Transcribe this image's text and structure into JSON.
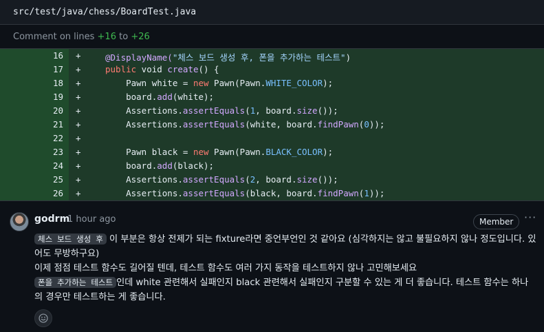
{
  "file": {
    "path": "src/test/java/chess/BoardTest.java"
  },
  "comment_range": {
    "prefix": "Comment on lines",
    "from": "+16",
    "joiner": "to",
    "to": "+26"
  },
  "code_lines": [
    {
      "num": "16",
      "sign": "+"
    },
    {
      "num": "17",
      "sign": "+"
    },
    {
      "num": "18",
      "sign": "+"
    },
    {
      "num": "19",
      "sign": "+"
    },
    {
      "num": "20",
      "sign": "+"
    },
    {
      "num": "21",
      "sign": "+"
    },
    {
      "num": "22",
      "sign": "+"
    },
    {
      "num": "23",
      "sign": "+"
    },
    {
      "num": "24",
      "sign": "+"
    },
    {
      "num": "25",
      "sign": "+"
    },
    {
      "num": "26",
      "sign": "+"
    }
  ],
  "code_text": {
    "l16_ann": "@DisplayName(",
    "l16_str": "\"체스 보드 생성 후, 폰을 추가하는 테스트\"",
    "l16_end": ")",
    "l17_kw": "public",
    "l17_rest": " void ",
    "l17_fn": "create",
    "l17_end": "() {",
    "l18_a": "    Pawn white = ",
    "l18_kw": "new",
    "l18_b": " Pawn(Pawn.",
    "l18_const": "WHITE_COLOR",
    "l18_c": ");",
    "l19_a": "    board.",
    "l19_fn": "add",
    "l19_b": "(white);",
    "l20_a": "    Assertions.",
    "l20_fn": "assertEquals",
    "l20_b": "(",
    "l20_num": "1",
    "l20_c": ", board.",
    "l20_fn2": "size",
    "l20_d": "());",
    "l21_a": "    Assertions.",
    "l21_fn": "assertEquals",
    "l21_b": "(white, board.",
    "l21_fn2": "findPawn",
    "l21_c": "(",
    "l21_num": "0",
    "l21_d": "));",
    "l23_a": "    Pawn black = ",
    "l23_kw": "new",
    "l23_b": " Pawn(Pawn.",
    "l23_const": "BLACK_COLOR",
    "l23_c": ");",
    "l24_a": "    board.",
    "l24_fn": "add",
    "l24_b": "(black);",
    "l25_a": "    Assertions.",
    "l25_fn": "assertEquals",
    "l25_b": "(",
    "l25_num": "2",
    "l25_c": ", board.",
    "l25_fn2": "size",
    "l25_d": "());",
    "l26_a": "    Assertions.",
    "l26_fn": "assertEquals",
    "l26_b": "(black, board.",
    "l26_fn2": "findPawn",
    "l26_c": "(",
    "l26_num": "1",
    "l26_d": "));"
  },
  "comment": {
    "author": "godrm",
    "time": "1 hour ago",
    "badge": "Member",
    "more_label": "···",
    "p1_code": "체스 보드 생성 후",
    "p1_text": " 이 부분은 항상 전제가 되는 fixture라면 중언부언인 것 같아요 (심각하지는 않고 불필요하지 않나 정도입니다. 있어도 무방하구요)",
    "p2_text": "이제 점점 테스트 함수도 길어질 텐데, 테스트 함수도 여러 가지 동작을 테스트하지 않나 고민해보세요",
    "p3_code": "폰을 추가하는 테스트",
    "p3_text": "인데 white 관련해서 실패인지 black 관련해서 실패인지 구분할 수 있는 게 더 좋습니다. 테스트 함수는 하나의 경우만 테스트하는 게 좋습니다."
  },
  "icons": {
    "reaction": "smiley-icon",
    "more": "kebab-icon"
  },
  "colors": {
    "added_bg": "#1e3a29",
    "added_gutter": "#1f4b2c",
    "range_num": "#3fb950"
  }
}
